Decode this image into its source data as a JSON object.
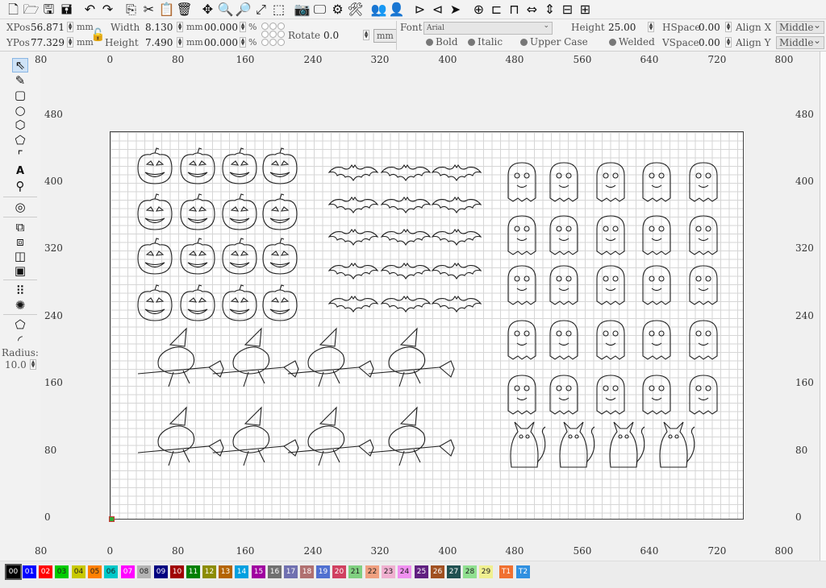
{
  "toolbar": {
    "icons": [
      "new-file-icon",
      "open-folder-icon",
      "save-icon",
      "save-as-icon",
      "undo-icon",
      "redo-icon",
      "copy-icon",
      "cut-icon",
      "paste-icon",
      "delete-icon",
      "move-icon",
      "zoom-in-icon",
      "zoom-out-icon",
      "zoom-fit-icon",
      "select-rect-icon",
      "camera-icon",
      "monitor-icon",
      "settings-icon",
      "tools-icon",
      "users-icon",
      "user-icon",
      "mirror-h-icon",
      "mirror-v-icon",
      "send-icon",
      "target-icon",
      "align-left-icon",
      "align-top-icon",
      "distribute-h-icon",
      "distribute-v-icon",
      "align-center-icon",
      "align-middle-icon"
    ],
    "glyphs": [
      "🗋",
      "🗁",
      "🖫",
      "🖬",
      "↶",
      "↷",
      "⎘",
      "✂",
      "📋",
      "🗑",
      "✥",
      "🔍",
      "🔎",
      "⤢",
      "⬚",
      "📷",
      "🖵",
      "⚙",
      "🛠",
      "👥",
      "👤",
      "⊳",
      "⊲",
      "➤",
      "⊕",
      "⊏",
      "⊓",
      "⇔",
      "⇕",
      "⊟",
      "⊞"
    ]
  },
  "propbar": {
    "xpos_label": "XPos",
    "xpos_value": "56.871",
    "ypos_label": "YPos",
    "ypos_value": "77.329",
    "unit": "mm",
    "width_label": "Width",
    "width_value": "8.130",
    "height_label": "Height",
    "height_value": "7.490",
    "scale_w": "00.000",
    "scale_h": "00.000",
    "pct": "%",
    "rotate_label": "Rotate",
    "rotate_value": "0.0",
    "mm_button": "mm",
    "font_label": "Font",
    "font_value": "Arial",
    "text_height_label": "Height",
    "text_height_value": "25.00",
    "hspace_label": "HSpace",
    "hspace_value": "0.00",
    "vspace_label": "VSpace",
    "vspace_value": "0.00",
    "align_x_label": "Align X",
    "align_x_value": "Middle",
    "align_y_label": "Align Y",
    "align_y_value": "Middle",
    "bold": "Bold",
    "italic": "Italic",
    "upper_case": "Upper Case",
    "welded": "Welded"
  },
  "lefttools": {
    "radius_label": "Radius:",
    "radius_value": "10.0"
  },
  "ruler": {
    "x_labels": [
      "80",
      "0",
      "80",
      "160",
      "240",
      "320",
      "400",
      "480",
      "560",
      "640",
      "720",
      "800"
    ],
    "y_labels": [
      "480",
      "400",
      "320",
      "240",
      "160",
      "80",
      "0"
    ]
  },
  "design": {
    "groups": [
      "pumpkins",
      "bats",
      "ghosts-and-owls",
      "witches",
      "cats"
    ]
  },
  "palette": [
    {
      "label": "00",
      "color": "#000000"
    },
    {
      "label": "01",
      "color": "#0000ff"
    },
    {
      "label": "02",
      "color": "#ff0000"
    },
    {
      "label": "03",
      "color": "#00cc00"
    },
    {
      "label": "04",
      "color": "#c8c800"
    },
    {
      "label": "05",
      "color": "#ff8000"
    },
    {
      "label": "06",
      "color": "#00c8c8"
    },
    {
      "label": "07",
      "color": "#ff00ff"
    },
    {
      "label": "08",
      "color": "#b4b4b4"
    },
    {
      "label": "09",
      "color": "#000080"
    },
    {
      "label": "10",
      "color": "#a00000"
    },
    {
      "label": "11",
      "color": "#008000"
    },
    {
      "label": "12",
      "color": "#8c8c00"
    },
    {
      "label": "13",
      "color": "#b46400"
    },
    {
      "label": "14",
      "color": "#00a0e0"
    },
    {
      "label": "15",
      "color": "#a000a0"
    },
    {
      "label": "16",
      "color": "#707070"
    },
    {
      "label": "17",
      "color": "#7070b0"
    },
    {
      "label": "18",
      "color": "#b07070"
    },
    {
      "label": "19",
      "color": "#5070d0"
    },
    {
      "label": "20",
      "color": "#d04060"
    },
    {
      "label": "21",
      "color": "#80d080"
    },
    {
      "label": "22",
      "color": "#f0a080"
    },
    {
      "label": "23",
      "color": "#f0b0d0"
    },
    {
      "label": "24",
      "color": "#f090f0"
    },
    {
      "label": "25",
      "color": "#602080"
    },
    {
      "label": "26",
      "color": "#a05020"
    },
    {
      "label": "27",
      "color": "#205050"
    },
    {
      "label": "28",
      "color": "#90e090"
    },
    {
      "label": "29",
      "color": "#f0f090"
    },
    {
      "label": "T1",
      "color": "#f07030"
    },
    {
      "label": "T2",
      "color": "#3090e0"
    }
  ]
}
